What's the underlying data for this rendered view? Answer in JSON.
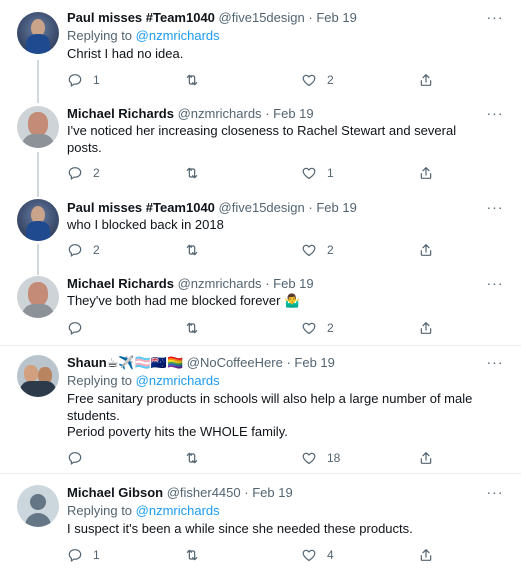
{
  "tweets": [
    {
      "name": "Paul misses #Team1040",
      "handle": "@five15design",
      "date": "Feb 19",
      "replying_label": "Replying to",
      "replying_to": "@nzmrichards",
      "text": [
        "Christ I had no idea."
      ],
      "replies": "1",
      "retweets": "",
      "likes": "2"
    },
    {
      "name": "Michael Richards",
      "handle": "@nzmrichards",
      "date": "Feb 19",
      "text": [
        "I've noticed her increasing closeness to Rachel Stewart and several posts."
      ],
      "replies": "2",
      "retweets": "",
      "likes": "1"
    },
    {
      "name": "Paul misses #Team1040",
      "handle": "@five15design",
      "date": "Feb 19",
      "text": [
        "who I blocked back in 2018"
      ],
      "replies": "2",
      "retweets": "",
      "likes": "2"
    },
    {
      "name": "Michael Richards",
      "handle": "@nzmrichards",
      "date": "Feb 19",
      "text": [
        "They've both had me blocked forever 🤷‍♂️"
      ],
      "replies": "",
      "retweets": "",
      "likes": "2"
    },
    {
      "name": "Shaun☕✈️🏳️‍⚧️🇳🇿🏳️‍🌈",
      "handle": "@NoCoffeeHere",
      "date": "Feb 19",
      "replying_label": "Replying to",
      "replying_to": "@nzmrichards",
      "text": [
        "Free sanitary products in schools will also help a large number of male students.",
        "Period poverty hits the WHOLE family."
      ],
      "replies": "",
      "retweets": "",
      "likes": "18"
    },
    {
      "name": "Michael Gibson",
      "handle": "@fisher4450",
      "date": "Feb 19",
      "replying_label": "Replying to",
      "replying_to": "@nzmrichards",
      "text": [
        "I suspect it's been a while since she needed these products."
      ],
      "replies": "1",
      "retweets": "",
      "likes": "4"
    }
  ],
  "ui": {
    "dot": "·",
    "more": "···"
  },
  "icons": {
    "reply": "reply-icon",
    "retweet": "retweet-icon",
    "like": "like-icon",
    "share": "share-icon",
    "more": "more-icon"
  },
  "colors": {
    "link": "#1d9bf0",
    "secondary": "#536471",
    "divider": "#e6ecf0",
    "thread_line": "#cfd9de"
  }
}
